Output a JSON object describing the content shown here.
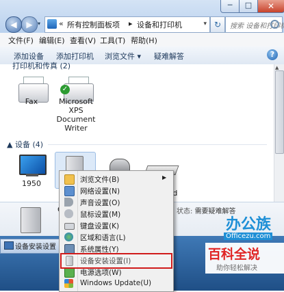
{
  "window": {
    "minimize_glyph": "─",
    "maximize_glyph": "□",
    "close_glyph": "✕"
  },
  "address": {
    "chevrons": "«",
    "crumb1": "所有控制面板项",
    "sep": "▸",
    "crumb2": "设备和打印机"
  },
  "search": {
    "placeholder": "搜索 设备和打印机"
  },
  "menubar": {
    "items": [
      "文件(F)",
      "编辑(E)",
      "查看(V)",
      "工具(T)",
      "帮助(H)"
    ]
  },
  "toolbar": {
    "add_device": "添加设备",
    "add_printer": "添加打印机",
    "browse_files": "浏览文件 ▾",
    "troubleshoot": "疑难解答",
    "help_glyph": "?"
  },
  "content": {
    "cut_header": "打印机和传真 (2)",
    "printers": [
      {
        "label": "Fax"
      },
      {
        "label": "Microsoft XPS Document Writer"
      }
    ],
    "devices_group": "▲ 设备 (4)",
    "devices": [
      {
        "label": "1950"
      },
      {
        "label": ""
      },
      {
        "label": ""
      },
      {
        "label": "rd"
      }
    ]
  },
  "details": {
    "status_label": "状态:",
    "status_value": "需要疑难解答",
    "partial_label": "C"
  },
  "taskbar": {
    "item_label": "设备安装设置"
  },
  "context_menu": {
    "items": [
      {
        "label": "浏览文件(B)",
        "icon": "folder-icon",
        "submenu": true
      },
      {
        "label": "网络设置(N)",
        "icon": "network-icon",
        "submenu": false
      },
      {
        "label": "声音设置(O)",
        "icon": "speaker-icon",
        "submenu": false
      },
      {
        "label": "鼠标设置(M)",
        "icon": "mouse-icon",
        "submenu": false
      },
      {
        "label": "键盘设置(K)",
        "icon": "keyboard-icon",
        "submenu": false
      },
      {
        "label": "区域和语言(L)",
        "icon": "globe-icon",
        "submenu": false
      },
      {
        "label": "系统属性(Y)",
        "icon": "system-icon",
        "submenu": false
      },
      {
        "label": "设备安装设置(I)",
        "icon": "device-install-icon",
        "submenu": false,
        "highlighted": true
      },
      {
        "label": "电源选项(W)",
        "icon": "power-icon",
        "submenu": false
      },
      {
        "label": "Windows Update(U)",
        "icon": "windows-update-icon",
        "submenu": false
      }
    ],
    "submenu_glyph": "▶",
    "highlight_color": "#d01a1a"
  },
  "watermarks": {
    "office_logo": "办公族",
    "office_url": "Officezu.com",
    "baike_title": "百科全说",
    "baike_sub": "助你轻松解决"
  },
  "colors": {
    "accent": "#1e8fd6",
    "brand_red": "#e02424"
  }
}
